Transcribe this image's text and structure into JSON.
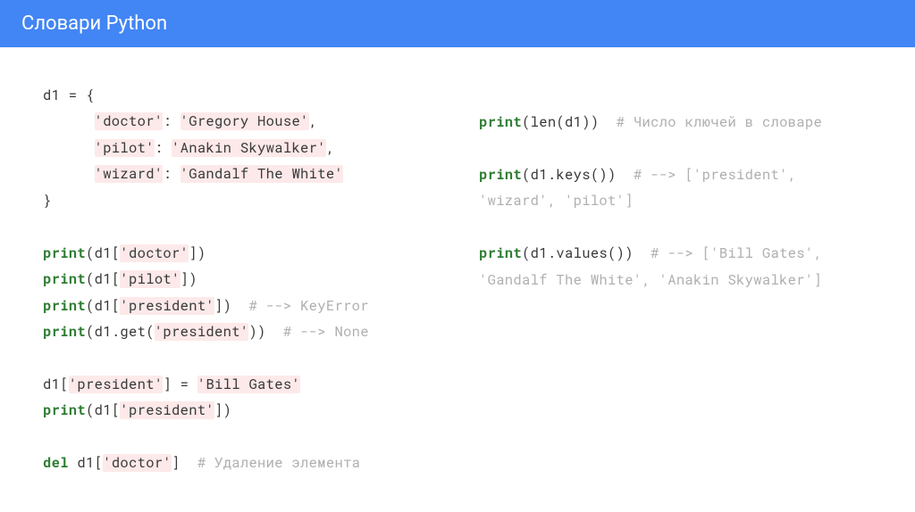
{
  "header": {
    "title": "Словари Python"
  },
  "left": {
    "l1": "d1 = {",
    "l2a": "      ",
    "l2s": "'doctor'",
    "l2b": ": ",
    "l2v": "'Gregory House'",
    "l2c": ",",
    "l3a": "      ",
    "l3s": "'pilot'",
    "l3b": ": ",
    "l3v": "'Anakin Skywalker'",
    "l3c": ",",
    "l4a": "      ",
    "l4s": "'wizard'",
    "l4b": ": ",
    "l4v": "'Gandalf The White'",
    "l5": "}",
    "p1k": "print",
    "p1a": "(d1[",
    "p1s": "'doctor'",
    "p1b": "])",
    "p2k": "print",
    "p2a": "(d1[",
    "p2s": "'pilot'",
    "p2b": "])",
    "p3k": "print",
    "p3a": "(d1[",
    "p3s": "'president'",
    "p3b": "])  ",
    "p3c": "# --> KeyError",
    "p4k": "print",
    "p4a": "(d1.get(",
    "p4s": "'president'",
    "p4b": "))  ",
    "p4c": "# --> None",
    "asg1": "d1[",
    "asg1s": "'president'",
    "asg1b": "] = ",
    "asg1v": "'Bill Gates'",
    "p5k": "print",
    "p5a": "(d1[",
    "p5s": "'president'",
    "p5b": "])",
    "delk": "del",
    "del1": " d1[",
    "del1s": "'doctor'",
    "del1b": "]  ",
    "delc": "# Удаление элемента"
  },
  "right": {
    "r1k": "print",
    "r1a": "(len(d1))  ",
    "r1c": "# Число ключей в словаре",
    "r2k": "print",
    "r2a": "(d1.keys())  ",
    "r2c": "# --> ['president', 'wizard', 'pilot']",
    "r3k": "print",
    "r3a": "(d1.values())  ",
    "r3c": "# --> ['Bill Gates', 'Gandalf The White', 'Anakin Skywalker']"
  }
}
